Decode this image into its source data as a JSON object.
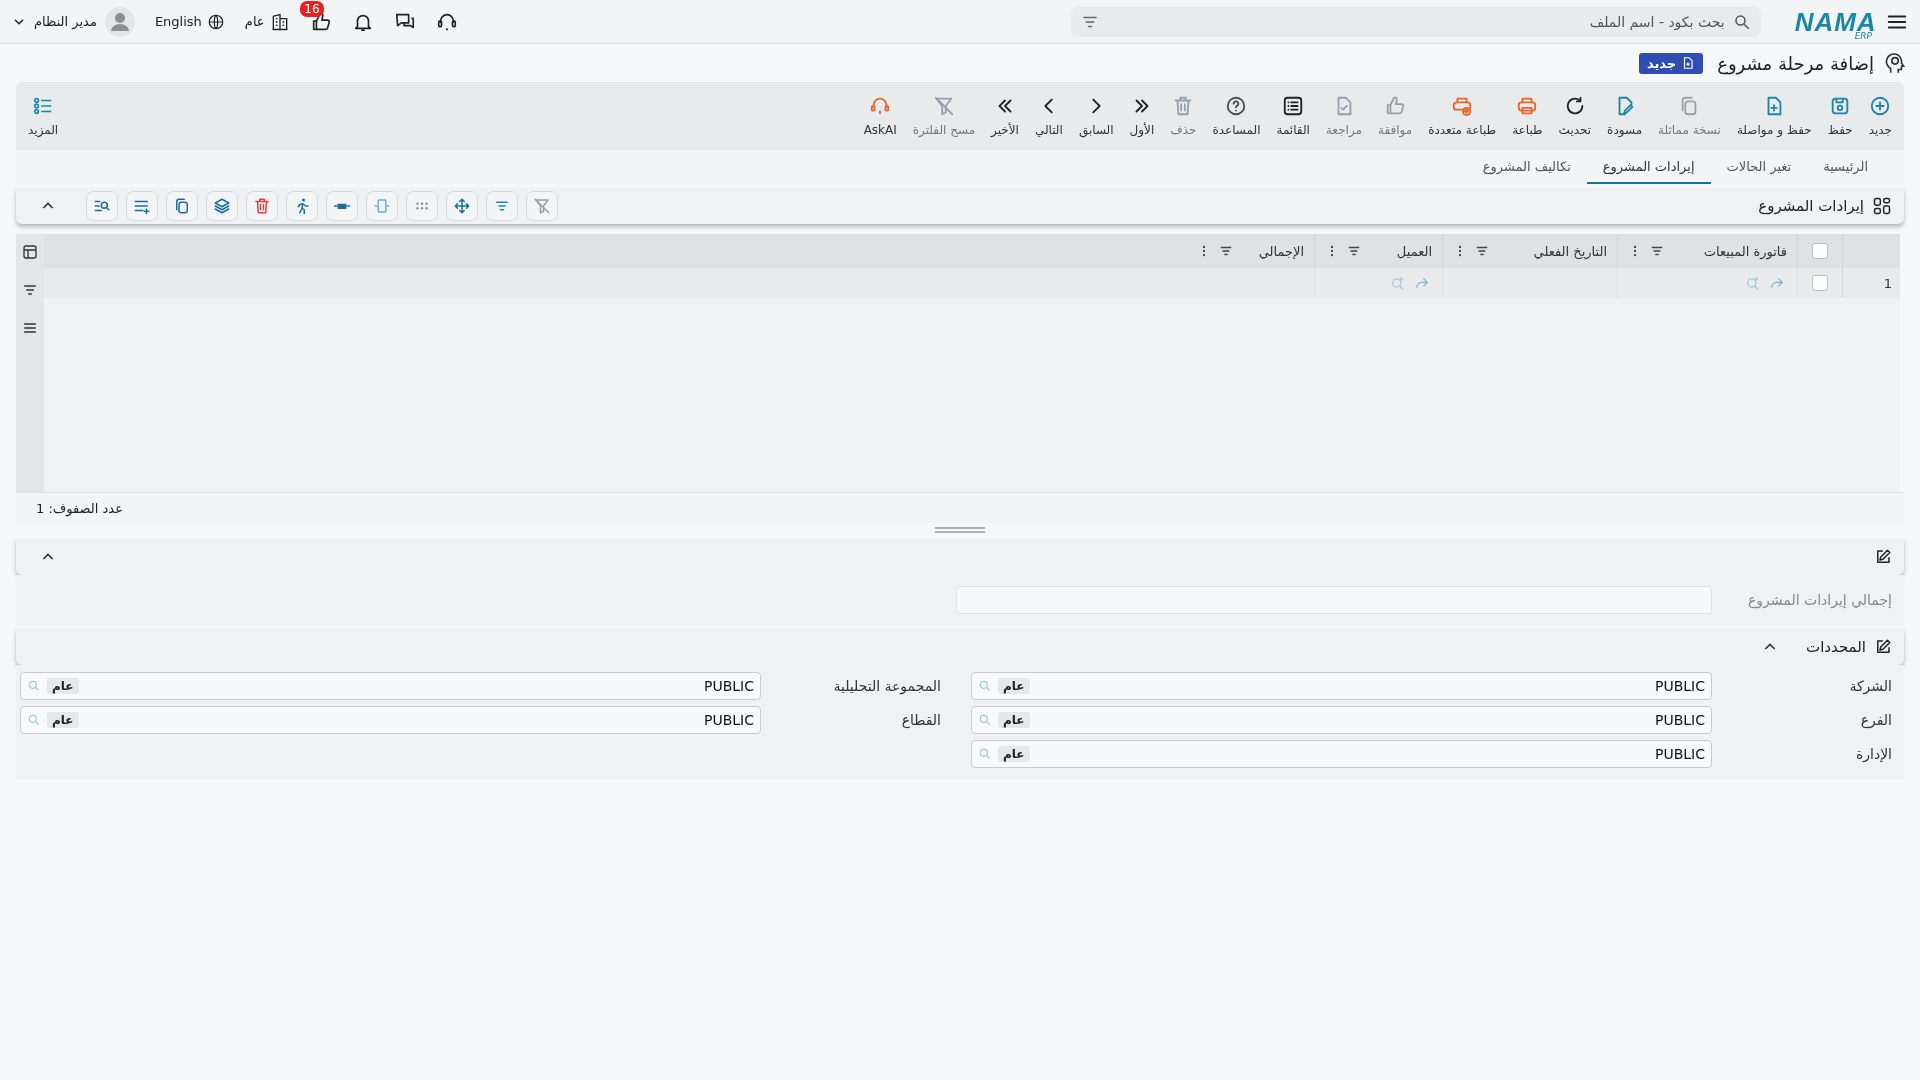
{
  "top_bar": {
    "logo": {
      "name": "NAMA",
      "sub": "ERP"
    },
    "search": {
      "placeholder": "بحث بكود - اسم الملف"
    },
    "notification_badge": "16",
    "branch": "عام",
    "language": "English",
    "user": "مدير النظام"
  },
  "page": {
    "title": "إضافة مرحلة مشروع",
    "status_badge": "جديد"
  },
  "toolbar": {
    "buttons": [
      {
        "label": "جديد",
        "color": "#1b87a8",
        "disabled": false
      },
      {
        "label": "حفظ",
        "color": "#1b87a8",
        "disabled": false
      },
      {
        "label": "حفظ و مواصلة",
        "color": "#1b87a8",
        "disabled": false
      },
      {
        "label": "نسخة مماثلة",
        "color": "#9aa0a6",
        "disabled": true
      },
      {
        "label": "مسودة",
        "color": "#1b87a8",
        "disabled": false
      },
      {
        "label": "تحديث",
        "color": "#222222",
        "disabled": false
      },
      {
        "label": "طباعة",
        "color": "#e8672a",
        "disabled": false
      },
      {
        "label": "طباعة متعددة",
        "color": "#e8672a",
        "disabled": false
      },
      {
        "label": "موافقة",
        "color": "#9aa0a6",
        "disabled": true
      },
      {
        "label": "مراجعة",
        "color": "#9aa0a6",
        "disabled": true
      },
      {
        "label": "القائمة",
        "color": "#222222",
        "disabled": false
      },
      {
        "label": "المساعدة",
        "color": "#4a4f57",
        "disabled": false
      },
      {
        "label": "حذف",
        "color": "#9aa0a6",
        "disabled": true
      },
      {
        "label": "الأول",
        "color": "#222222",
        "disabled": false
      },
      {
        "label": "السابق",
        "color": "#222222",
        "disabled": false
      },
      {
        "label": "التالي",
        "color": "#222222",
        "disabled": false
      },
      {
        "label": "الأخير",
        "color": "#222222",
        "disabled": false
      },
      {
        "label": "مسح الفلترة",
        "color": "#9aa0a6",
        "disabled": true
      },
      {
        "label": "AskAI",
        "color": "#e8672a",
        "disabled": false
      }
    ],
    "more": "المزيد"
  },
  "tabs": [
    {
      "label": "الرئيسية",
      "selected": false
    },
    {
      "label": "تغير الحالات",
      "selected": false
    },
    {
      "label": "إيرادات المشروع",
      "selected": true
    },
    {
      "label": "تكاليف المشروع",
      "selected": false
    }
  ],
  "grid_section": {
    "title": "إيرادات المشروع",
    "expanded": true
  },
  "grid": {
    "header_checked": false,
    "columns": [
      {
        "label": "فاتورة المبيعات",
        "lookup": true
      },
      {
        "label": "التاريخ الفعلي",
        "lookup": false
      },
      {
        "label": "العميل",
        "lookup": true
      },
      {
        "label": "الإجمالي",
        "lookup": false
      }
    ],
    "rows": [
      {
        "number": "1",
        "checked": false
      }
    ],
    "row_count": "عدد الصفوف: 1"
  },
  "totals_section": {
    "expanded": true,
    "fields": [
      {
        "label": "إجمالي إيرادات المشروع",
        "disabled": true
      }
    ]
  },
  "dimensions": {
    "title": "المحددات",
    "expanded": true,
    "columns": [
      [
        {
          "label": "الشركة",
          "value": "PUBLIC",
          "tag": "عام"
        },
        {
          "label": "الفرع",
          "value": "PUBLIC",
          "tag": "عام"
        },
        {
          "label": "الإدارة",
          "value": "PUBLIC",
          "tag": "عام"
        }
      ],
      [
        {
          "label": "المجموعة التحليلية",
          "value": "PUBLIC",
          "tag": "عام"
        },
        {
          "label": "القطاع",
          "value": "PUBLIC",
          "tag": "عام"
        }
      ]
    ]
  }
}
